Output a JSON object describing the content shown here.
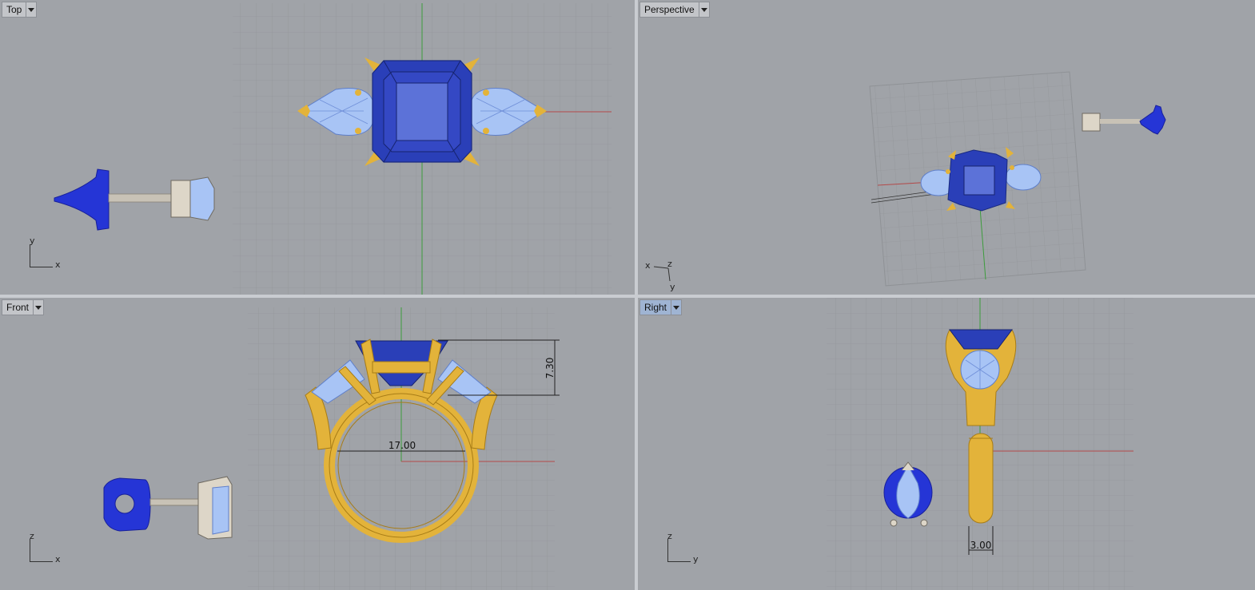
{
  "viewports": {
    "top": {
      "label": "Top",
      "axes": {
        "vertical": "y",
        "horizontal": "x"
      }
    },
    "perspective": {
      "label": "Perspective",
      "axes": {
        "vertical": "y",
        "horizontal": "x",
        "depth": "z"
      }
    },
    "front": {
      "label": "Front",
      "axes": {
        "vertical": "z",
        "horizontal": "x"
      },
      "dimensions": {
        "height": "7.30",
        "width": "17.00"
      }
    },
    "right": {
      "label": "Right",
      "axes": {
        "vertical": "z",
        "horizontal": "y"
      },
      "dimensions": {
        "band_width": "3.00"
      }
    }
  },
  "colors": {
    "viewport_bg": "#a0a3a8",
    "grid_line": "#8f9296",
    "gold": "#e3b33a",
    "gold_dark": "#a77c17",
    "sapphire": "#2a3fb8",
    "sapphire_light": "#5c72d8",
    "diamond": "#a8c4f5",
    "x_axis": "#b44a4a",
    "y_axis": "#3c9c3c"
  }
}
